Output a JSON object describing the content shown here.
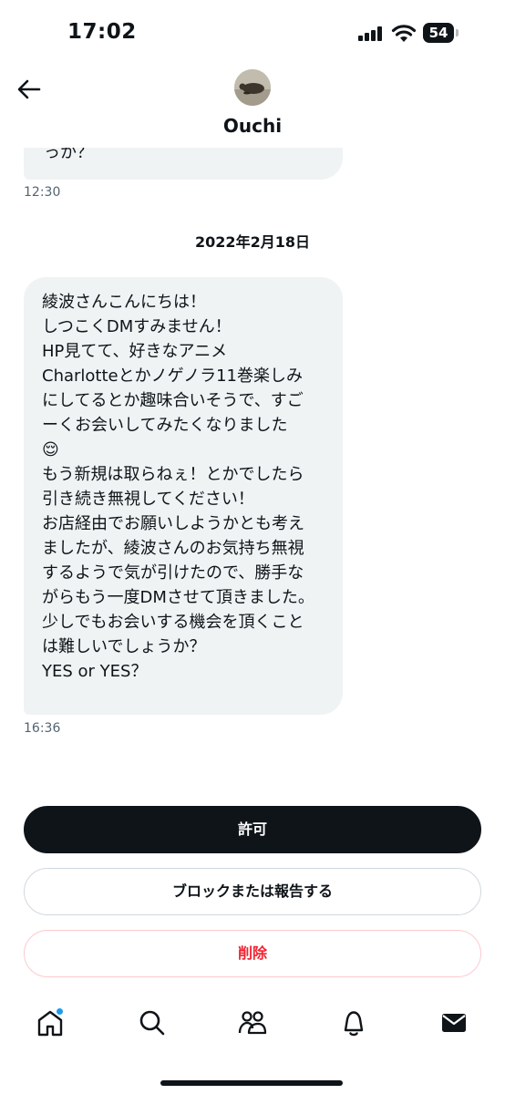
{
  "status_bar": {
    "time": "17:02",
    "battery": "54",
    "icons": [
      "signal-icon",
      "wifi-icon",
      "battery-icon"
    ]
  },
  "header": {
    "back_icon": "arrow-left-icon",
    "contact_name": "Ouchi",
    "avatar_icon": "avatar"
  },
  "previous_message": {
    "text": "っか？",
    "time": "12:30"
  },
  "date_separator": "2022年2月18日",
  "message": {
    "lines": [
      "綾波さんこんにちは！",
      "しつこくDMすみません！",
      "HP見てて、好きなアニメ",
      "Charlotteとかノゲノラ11巻楽しみ",
      "にしてるとか趣味合いそうで、すご",
      "ーくお会いしてみたくなりました",
      "😌",
      "もう新規は取らねぇ！とかでしたら",
      "引き続き無視してください！",
      "お店経由でお願いしようかとも考え",
      "ましたが、綾波さんのお気持ち無視",
      "するようで気が引けたので、勝手な",
      "がらもう一度DMさせて頂きました。",
      "少しでもお会いする機会を頂くこと",
      "は難しいでしょうか？",
      "YES or YES？"
    ],
    "time": "16:36"
  },
  "actions": {
    "allow": "許可",
    "block_report": "ブロックまたは報告する",
    "delete": "削除"
  },
  "tab_bar": {
    "items": [
      "home-icon",
      "search-icon",
      "communities-icon",
      "notifications-icon",
      "messages-icon"
    ]
  },
  "colors": {
    "bubble": "#eff3f4",
    "primary": "#0f1419",
    "danger": "#f4212e",
    "accent": "#1d9bf0"
  }
}
